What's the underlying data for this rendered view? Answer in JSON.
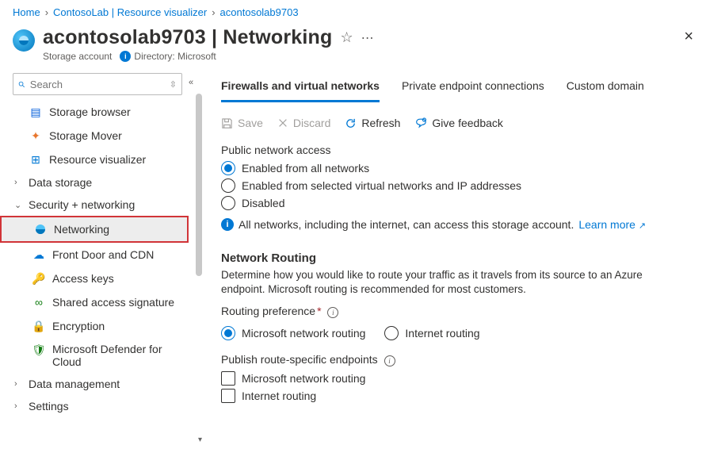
{
  "breadcrumbs": {
    "home": "Home",
    "mid": "ContosoLab | Resource visualizer",
    "last": "acontosolab9703"
  },
  "header": {
    "title": "acontosolab9703 | Networking",
    "subtitle": "Storage account",
    "directory_label": "Directory: Microsoft"
  },
  "search": {
    "placeholder": "Search"
  },
  "sidebar": {
    "items": [
      {
        "label": "Storage browser"
      },
      {
        "label": "Storage Mover"
      },
      {
        "label": "Resource visualizer"
      },
      {
        "label": "Data storage"
      },
      {
        "label": "Security + networking"
      },
      {
        "label": "Networking"
      },
      {
        "label": "Front Door and CDN"
      },
      {
        "label": "Access keys"
      },
      {
        "label": "Shared access signature"
      },
      {
        "label": "Encryption"
      },
      {
        "label": "Microsoft Defender for Cloud"
      },
      {
        "label": "Data management"
      },
      {
        "label": "Settings"
      }
    ]
  },
  "tabs": {
    "firewalls": "Firewalls and virtual networks",
    "private": "Private endpoint connections",
    "custom": "Custom domain"
  },
  "toolbar": {
    "save": "Save",
    "discard": "Discard",
    "refresh": "Refresh",
    "feedback": "Give feedback"
  },
  "public_access": {
    "heading": "Public network access",
    "opt1": "Enabled from all networks",
    "opt2": "Enabled from selected virtual networks and IP addresses",
    "opt3": "Disabled",
    "info_text": "All networks, including the internet, can access this storage account.",
    "learn_more": "Learn more"
  },
  "routing": {
    "heading": "Network Routing",
    "desc": "Determine how you would like to route your traffic as it travels from its source to an Azure endpoint. Microsoft routing is recommended for most customers.",
    "pref_label": "Routing preference",
    "opt_ms": "Microsoft network routing",
    "opt_internet": "Internet routing",
    "publish_label": "Publish route-specific endpoints",
    "chk_ms": "Microsoft network routing",
    "chk_internet": "Internet routing"
  }
}
